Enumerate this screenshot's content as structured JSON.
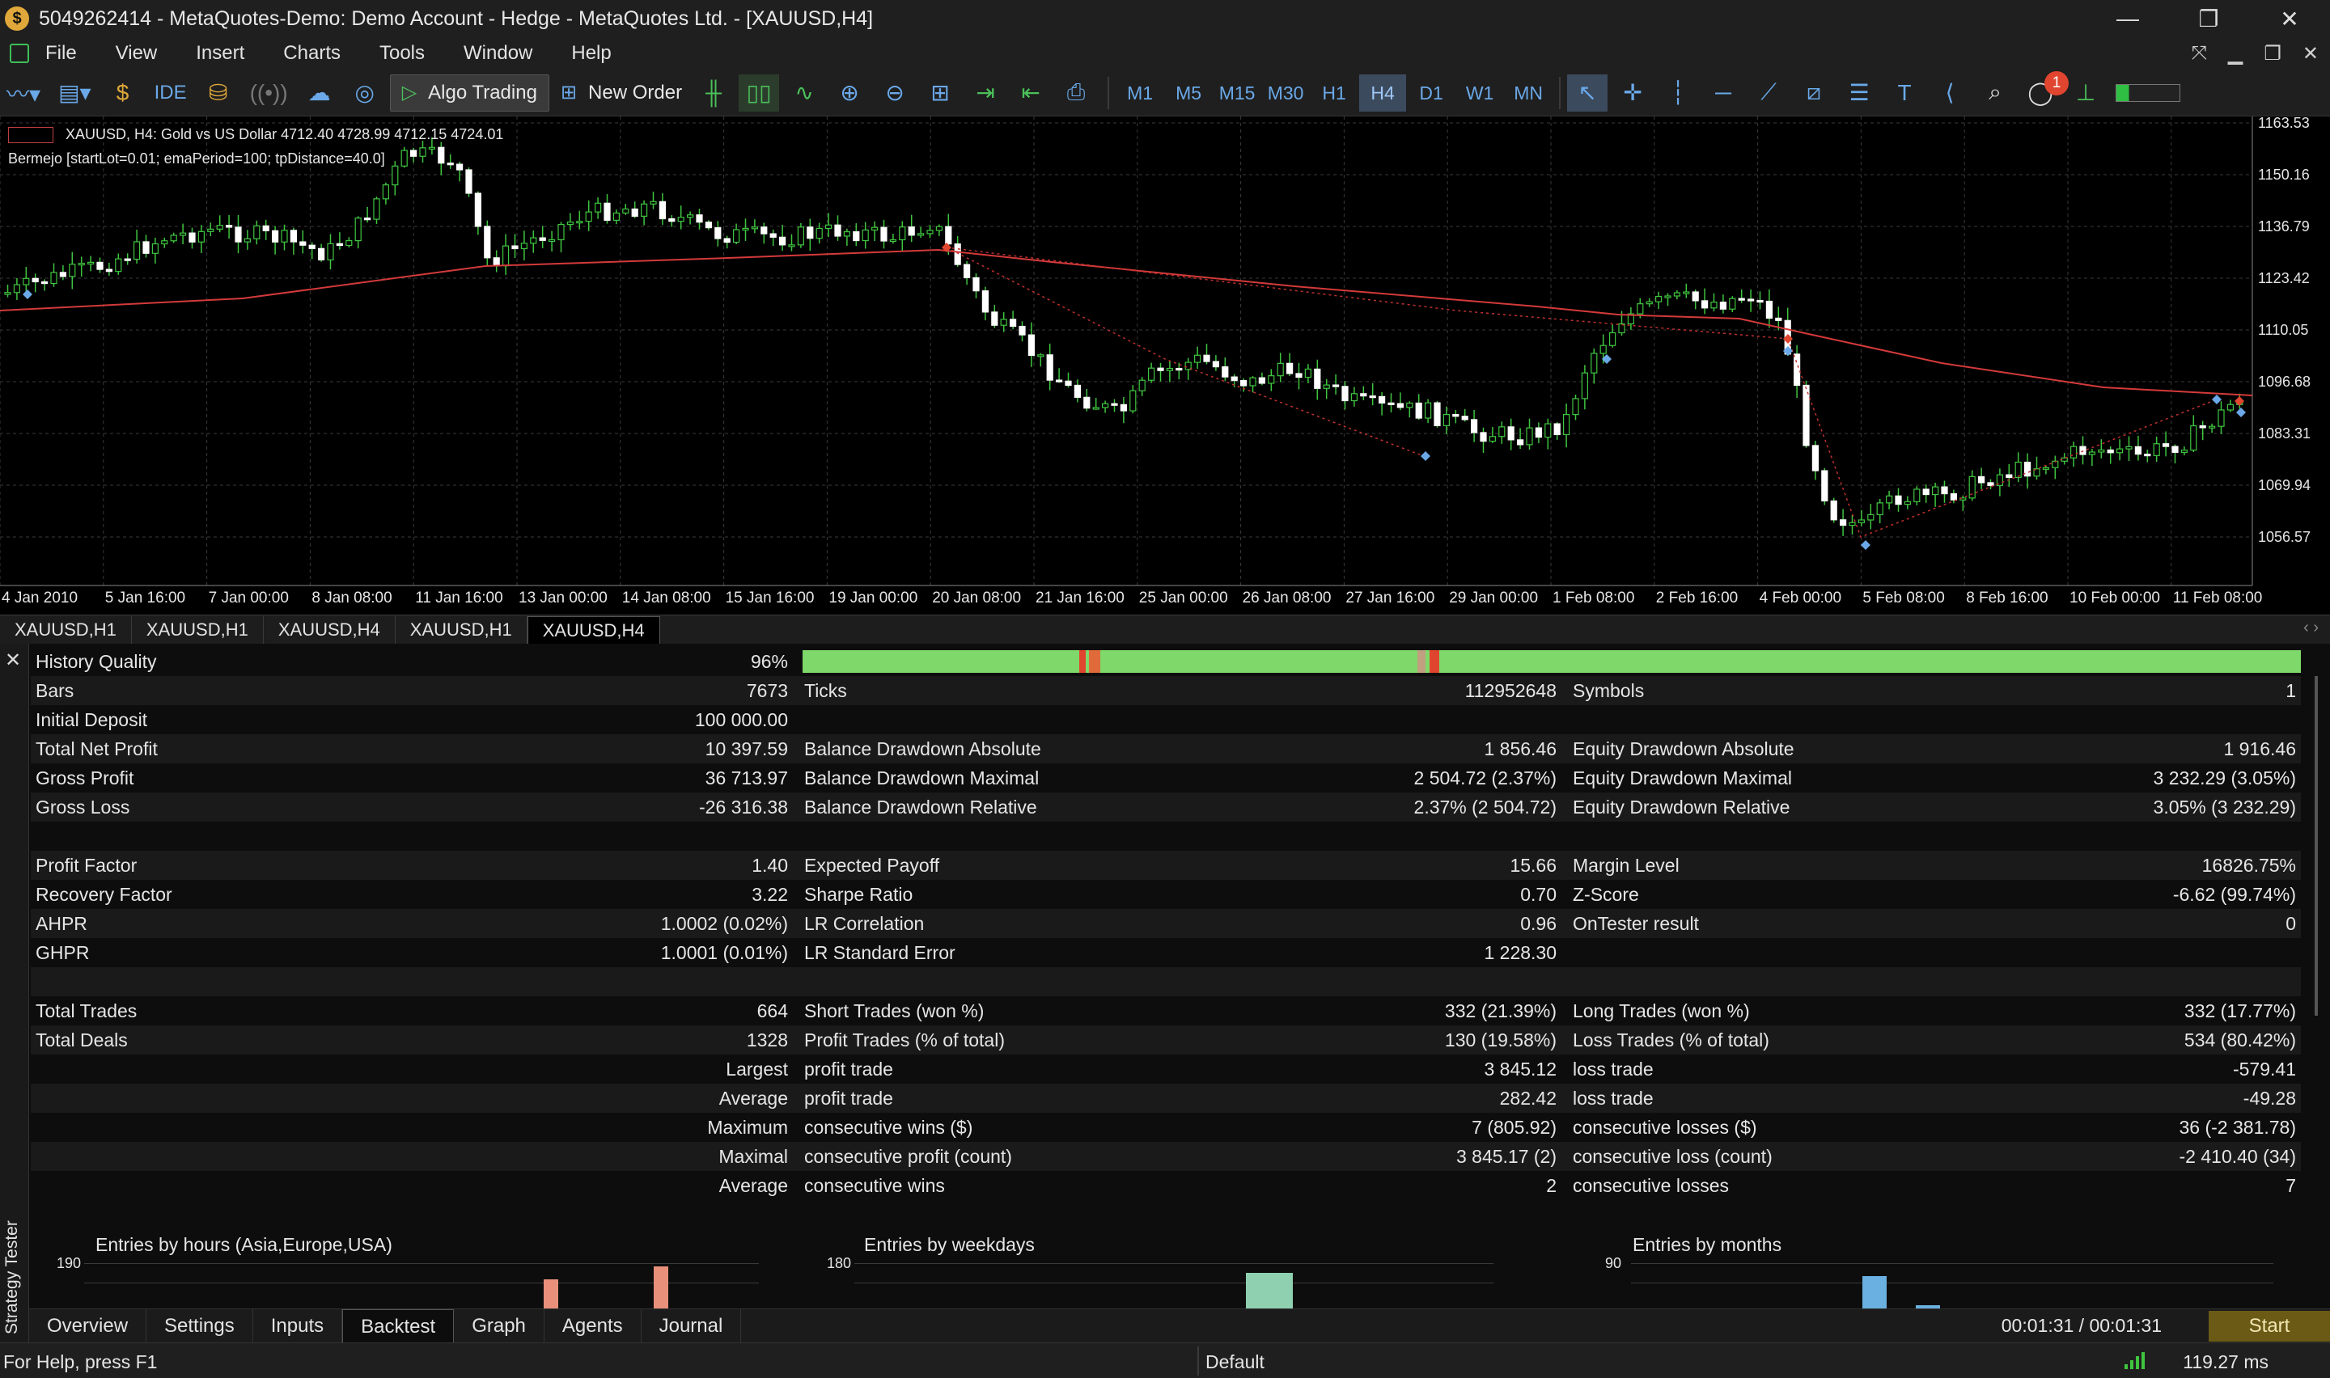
{
  "titlebar": {
    "title": "5049262414 - MetaQuotes-Demo: Demo Account - Hedge - MetaQuotes Ltd. - [XAUUSD,H4]",
    "minimize": "—",
    "restore": "❐",
    "close": "✕"
  },
  "menu": {
    "items": [
      "File",
      "View",
      "Insert",
      "Charts",
      "Tools",
      "Window",
      "Help"
    ],
    "right_icons": [
      "pin-icon",
      "minimize-icon",
      "restore-icon",
      "close-icon"
    ]
  },
  "toolbar": {
    "ide_label": "IDE",
    "algo_label": "Algo Trading",
    "new_order_label": "New Order",
    "timeframes": [
      "M1",
      "M5",
      "M15",
      "M30",
      "H1",
      "H4",
      "D1",
      "W1",
      "MN"
    ],
    "active_timeframe": "H4",
    "notification_count": "1"
  },
  "chart": {
    "symbol_line": "XAUUSD, H4:  Gold vs US Dollar  4712.40 4728.99 4712.15 4724.01",
    "indicator_line": "Bermejo [startLot=0.01; emaPeriod=100; tpDistance=40.0]",
    "y_ticks": [
      "1163.53",
      "1150.16",
      "1136.79",
      "1123.42",
      "1110.05",
      "1096.68",
      "1083.31",
      "1069.94",
      "1056.57"
    ],
    "x_ticks": [
      "4 Jan 2010",
      "5 Jan 16:00",
      "7 Jan 00:00",
      "8 Jan 08:00",
      "11 Jan 16:00",
      "13 Jan 00:00",
      "14 Jan 08:00",
      "15 Jan 16:00",
      "19 Jan 00:00",
      "20 Jan 08:00",
      "21 Jan 16:00",
      "25 Jan 00:00",
      "26 Jan 08:00",
      "27 Jan 16:00",
      "29 Jan 00:00",
      "1 Feb 08:00",
      "2 Feb 16:00",
      "4 Feb 00:00",
      "5 Feb 08:00",
      "8 Feb 16:00",
      "10 Feb 00:00",
      "11 Feb 08:00"
    ],
    "colors": {
      "bull": "#ffffff",
      "bear": "#ffffff",
      "wick": "#3fc53f",
      "ema": "#d43a3a",
      "grid": "#3a3a3a"
    }
  },
  "chart_tabs": [
    "XAUUSD,H1",
    "XAUUSD,H1",
    "XAUUSD,H4",
    "XAUUSD,H1",
    "XAUUSD,H4"
  ],
  "active_chart_tab": 4,
  "tester": {
    "side_title": "Strategy Tester",
    "rows": [
      [
        [
          "History Quality",
          "96%"
        ],
        null,
        null
      ],
      [
        [
          "Bars",
          "7673"
        ],
        [
          "Ticks",
          "112952648"
        ],
        [
          "Symbols",
          "1"
        ]
      ],
      [
        [
          "Initial Deposit",
          "100 000.00"
        ],
        null,
        null
      ],
      [
        [
          "Total Net Profit",
          "10 397.59"
        ],
        [
          "Balance Drawdown Absolute",
          "1 856.46"
        ],
        [
          "Equity Drawdown Absolute",
          "1 916.46"
        ]
      ],
      [
        [
          "Gross Profit",
          "36 713.97"
        ],
        [
          "Balance Drawdown Maximal",
          "2 504.72 (2.37%)"
        ],
        [
          "Equity Drawdown Maximal",
          "3 232.29 (3.05%)"
        ]
      ],
      [
        [
          "Gross Loss",
          "-26 316.38"
        ],
        [
          "Balance Drawdown Relative",
          "2.37% (2 504.72)"
        ],
        [
          "Equity Drawdown Relative",
          "3.05% (3 232.29)"
        ]
      ],
      [
        null,
        null,
        null
      ],
      [
        [
          "Profit Factor",
          "1.40"
        ],
        [
          "Expected Payoff",
          "15.66"
        ],
        [
          "Margin Level",
          "16826.75%"
        ]
      ],
      [
        [
          "Recovery Factor",
          "3.22"
        ],
        [
          "Sharpe Ratio",
          "0.70"
        ],
        [
          "Z-Score",
          "-6.62 (99.74%)"
        ]
      ],
      [
        [
          "AHPR",
          "1.0002 (0.02%)"
        ],
        [
          "LR Correlation",
          "0.96"
        ],
        [
          "OnTester result",
          "0"
        ]
      ],
      [
        [
          "GHPR",
          "1.0001 (0.01%)"
        ],
        [
          "LR Standard Error",
          "1 228.30"
        ],
        null
      ],
      [
        null,
        null,
        null
      ],
      [
        [
          "Total Trades",
          "664"
        ],
        [
          "Short Trades (won %)",
          "332 (21.39%)"
        ],
        [
          "Long Trades (won %)",
          "332 (17.77%)"
        ]
      ],
      [
        [
          "Total Deals",
          "1328"
        ],
        [
          "Profit Trades (% of total)",
          "130 (19.58%)"
        ],
        [
          "Loss Trades (% of total)",
          "534 (80.42%)"
        ]
      ],
      [
        [
          "",
          "Largest"
        ],
        [
          "profit trade",
          "3 845.12"
        ],
        [
          "loss trade",
          "-579.41"
        ]
      ],
      [
        [
          "",
          "Average"
        ],
        [
          "profit trade",
          "282.42"
        ],
        [
          "loss trade",
          "-49.28"
        ]
      ],
      [
        [
          "",
          "Maximum"
        ],
        [
          "consecutive wins ($)",
          "7 (805.92)"
        ],
        [
          "consecutive losses ($)",
          "36 (-2 381.78)"
        ]
      ],
      [
        [
          "",
          "Maximal"
        ],
        [
          "consecutive profit (count)",
          "3 845.17 (2)"
        ],
        [
          "consecutive loss (count)",
          "-2 410.40 (34)"
        ]
      ],
      [
        [
          "",
          "Average"
        ],
        [
          "consecutive wins",
          "2"
        ],
        [
          "consecutive losses",
          "7"
        ]
      ]
    ],
    "mini_charts": [
      {
        "title": "Entries by hours (Asia,Europe,USA)",
        "axis": "190"
      },
      {
        "title": "Entries by weekdays",
        "axis": "180"
      },
      {
        "title": "Entries by months",
        "axis": "90"
      }
    ]
  },
  "bottom_tabs": [
    "Overview",
    "Settings",
    "Inputs",
    "Backtest",
    "Graph",
    "Agents",
    "Journal"
  ],
  "active_bottom_tab": 3,
  "timer": "00:01:31 / 00:01:31",
  "start_label": "Start",
  "status": {
    "help": "For Help, press F1",
    "profile": "Default",
    "ping": "119.27 ms"
  }
}
